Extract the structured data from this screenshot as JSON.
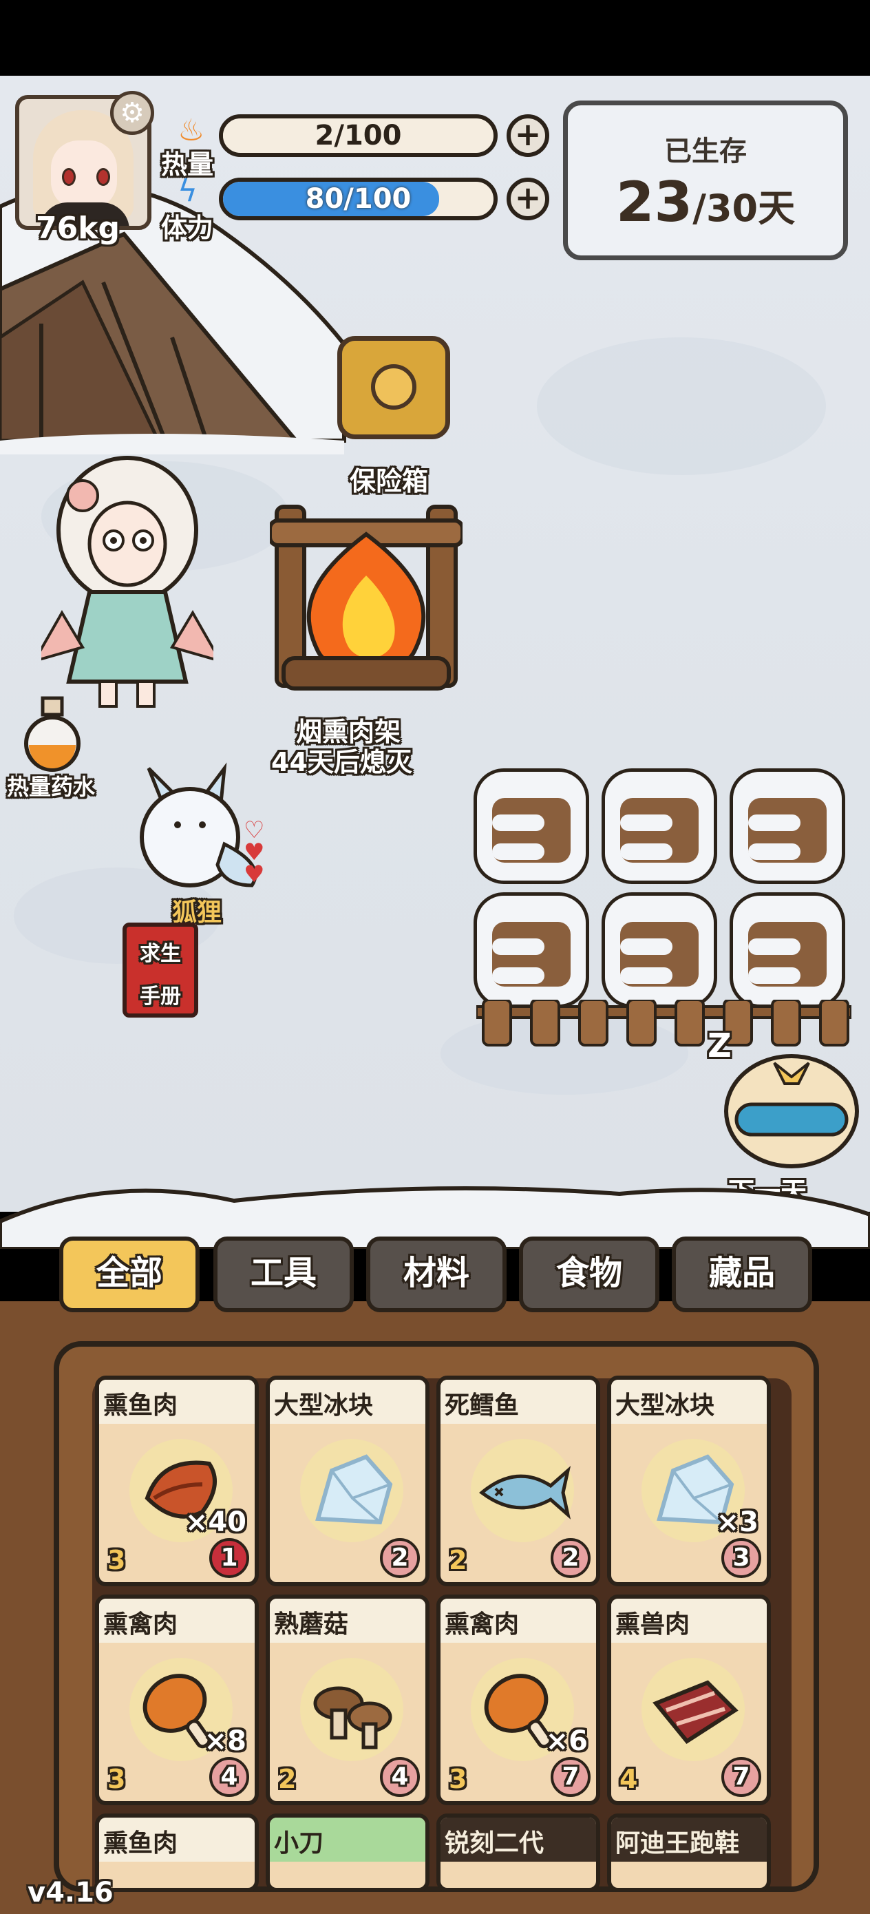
{
  "hud": {
    "weight": "76kg",
    "heat_label": "热量",
    "stamina_label": "体力",
    "heat_value": "2/100",
    "heat_fraction": 0.02,
    "stamina_value": "80/100",
    "stamina_fraction": 0.8,
    "survived_label": "已生存",
    "survived_days": "23",
    "survived_total": "/30天"
  },
  "scene": {
    "safe_label": "保险箱",
    "rack_label": "烟熏肉架",
    "rack_status": "44天后熄灭",
    "potion_label": "热量药水",
    "fox_label": "狐狸",
    "manual_line1": "求生",
    "manual_line2": "手册",
    "next_day_label": "下一天",
    "sleep_mark": "Z"
  },
  "tabs": [
    "全部",
    "工具",
    "材料",
    "食物",
    "藏品"
  ],
  "items": [
    {
      "name": "熏鱼肉",
      "qty": "×40",
      "level": "3",
      "cost": "1",
      "icon": "smoked-fish-icon",
      "cost_style": "red"
    },
    {
      "name": "大型冰块",
      "qty": "",
      "level": "",
      "cost": "2",
      "icon": "ice-block-icon",
      "cost_style": "pink"
    },
    {
      "name": "死鳕鱼",
      "qty": "",
      "level": "2",
      "cost": "2",
      "icon": "dead-cod-icon",
      "cost_style": "pink"
    },
    {
      "name": "大型冰块",
      "qty": "×3",
      "level": "",
      "cost": "3",
      "icon": "ice-block-icon",
      "cost_style": "pink"
    },
    {
      "name": "熏禽肉",
      "qty": "×8",
      "level": "3",
      "cost": "4",
      "icon": "drumstick-icon",
      "cost_style": "pink"
    },
    {
      "name": "熟蘑菇",
      "qty": "",
      "level": "2",
      "cost": "4",
      "icon": "mushroom-icon",
      "cost_style": "pink"
    },
    {
      "name": "熏禽肉",
      "qty": "×6",
      "level": "3",
      "cost": "7",
      "icon": "drumstick-icon",
      "cost_style": "pink"
    },
    {
      "name": "熏兽肉",
      "qty": "",
      "level": "4",
      "cost": "7",
      "icon": "meat-icon",
      "cost_style": "pink"
    },
    {
      "name": "熏鱼肉",
      "header_style": "plain"
    },
    {
      "name": "小刀",
      "header_style": "tool"
    },
    {
      "name": "锐刻二代",
      "header_style": "dark"
    },
    {
      "name": "阿迪王跑鞋",
      "header_style": "dark"
    }
  ],
  "version": "v4.16",
  "colors": {
    "heat_fill": "#f5ede0",
    "stamina_fill": "#3a8fe0",
    "tab_active": "#f3c65a",
    "tab_inactive": "#57504b",
    "panel_wood": "#8a5b34"
  }
}
